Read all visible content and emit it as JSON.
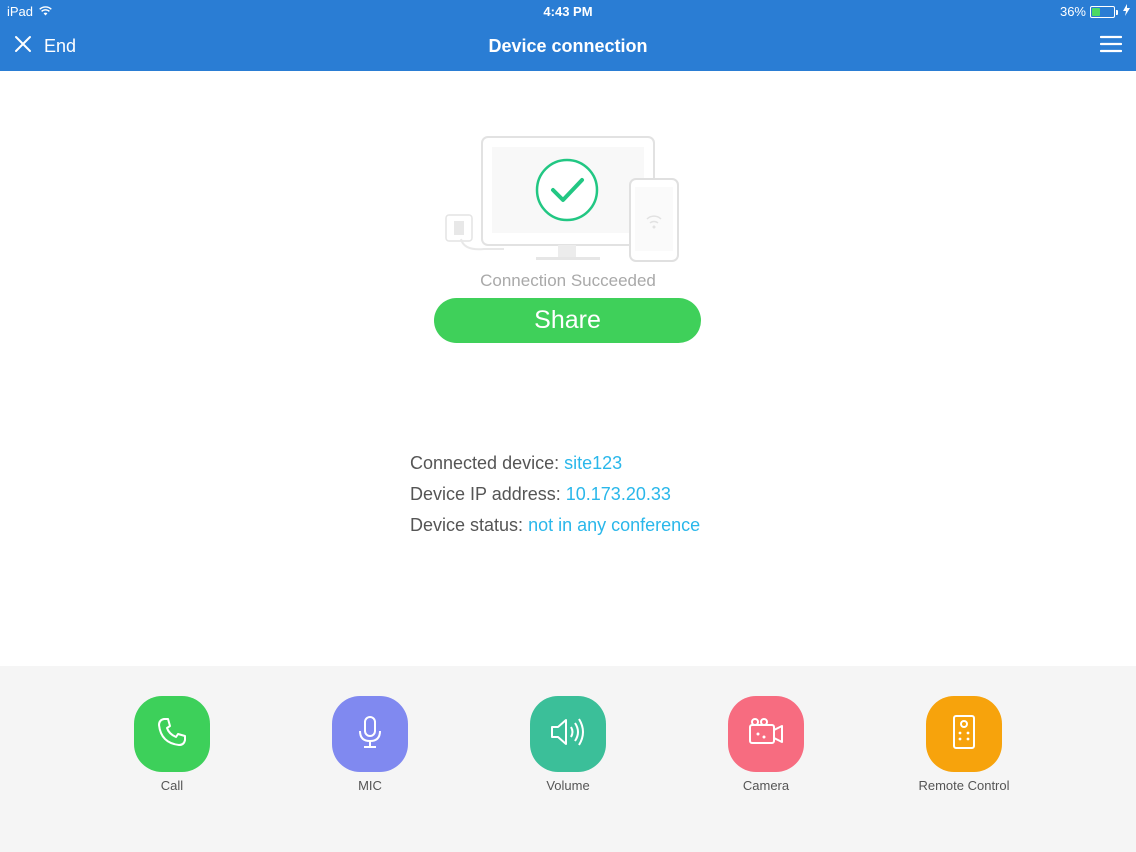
{
  "status_bar": {
    "device": "iPad",
    "time": "4:43 PM",
    "battery_percent": "36%",
    "battery_level": 0.36
  },
  "nav": {
    "end_label": "End",
    "title": "Device connection"
  },
  "connection": {
    "status_text": "Connection Succeeded",
    "share_label": "Share"
  },
  "info": {
    "connected_device_label": "Connected device:",
    "connected_device_value": "site123",
    "ip_label": "Device IP address:",
    "ip_value": "10.173.20.33",
    "status_label": "Device status:",
    "status_value": "not in any conference"
  },
  "dock": {
    "items": [
      {
        "label": "Call",
        "icon": "phone-icon",
        "color": "#3dd05a"
      },
      {
        "label": "MIC",
        "icon": "microphone-icon",
        "color": "#8089f0"
      },
      {
        "label": "Volume",
        "icon": "speaker-icon",
        "color": "#3bbf99"
      },
      {
        "label": "Camera",
        "icon": "video-camera-icon",
        "color": "#f76c80"
      },
      {
        "label": "Remote Control",
        "icon": "remote-control-icon",
        "color": "#f7a30c"
      }
    ]
  },
  "colors": {
    "header": "#2a7dd4",
    "accent_green": "#3fd05a",
    "link_blue": "#2ab7ea"
  }
}
